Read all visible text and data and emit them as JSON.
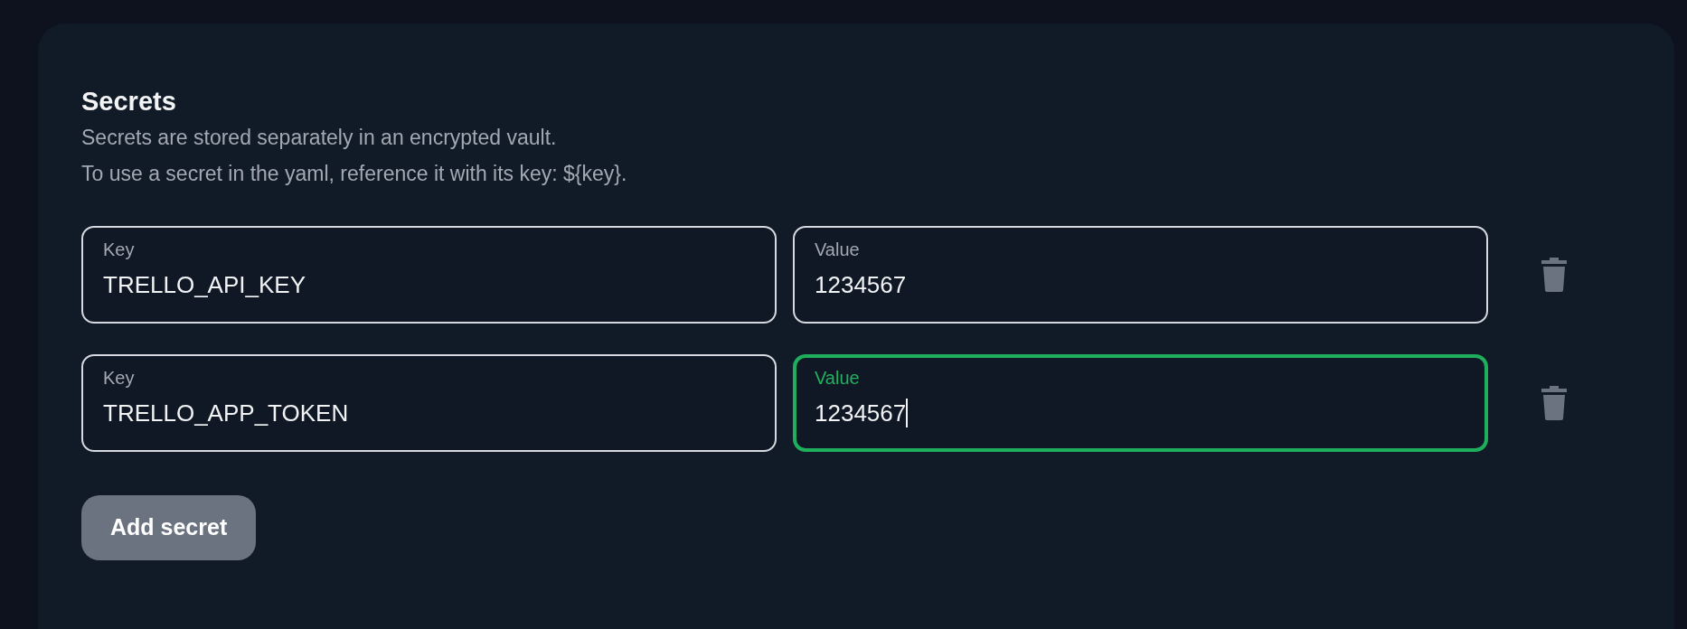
{
  "section": {
    "title": "Secrets",
    "description": [
      "Secrets are stored separately in an encrypted vault.",
      "To use a secret in the yaml, reference it with its key: ${key}."
    ]
  },
  "secrets": [
    {
      "key": {
        "label": "Key",
        "value": "TRELLO_API_KEY",
        "focused": false
      },
      "value": {
        "label": "Value",
        "value": "1234567",
        "focused": false
      }
    },
    {
      "key": {
        "label": "Key",
        "value": "TRELLO_APP_TOKEN",
        "focused": false
      },
      "value": {
        "label": "Value",
        "value": "1234567",
        "focused": true
      }
    }
  ],
  "add_button": "Add secret"
}
